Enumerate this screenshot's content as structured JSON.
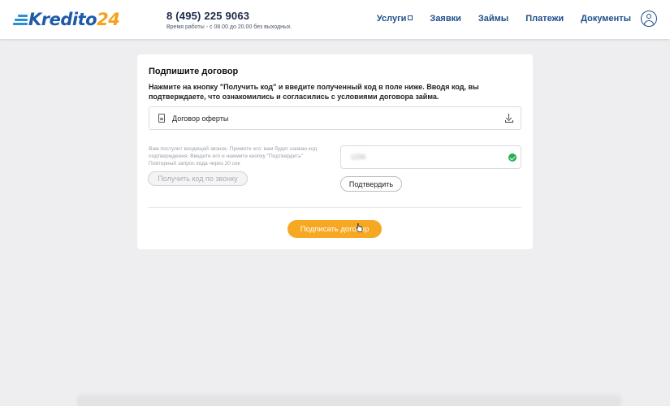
{
  "header": {
    "logo_part1": "Kredito",
    "logo_part2": "24",
    "phone": "8 (495) 225 9063",
    "hours": "Время работы - с 08.00 до 20.00 без выходных.",
    "nav": [
      "Услуги",
      "Заявки",
      "Займы",
      "Платежи",
      "Документы"
    ]
  },
  "card": {
    "title": "Подпишите договор",
    "description": "Нажмите на кнопку \"Получить код\" и введите полученный код в поле ниже. Вводя код, вы подтверждаете, что ознакомились и согласились с условиями договора займа.",
    "document_label": "Договор оферты",
    "call_info": "Вам поступит входящий звонок. Примите его: вам будет назван код подтверждения. Введите его и нажмите кнопку \"Подтвердить\"",
    "repeat_info": "Повторный запрос кода через 20 сек",
    "call_button": "Получить код по звонку",
    "code_value": "1234",
    "confirm_button": "Подтвердить",
    "sign_button": "Подписать договор"
  },
  "colors": {
    "accent": "#f7a823",
    "brand_blue": "#1d5aa8",
    "success": "#22b14c"
  },
  "icons": {
    "document": "file-icon",
    "download": "download-icon",
    "profile": "user-icon",
    "external": "external-link-icon",
    "status": "check-circle-icon"
  }
}
